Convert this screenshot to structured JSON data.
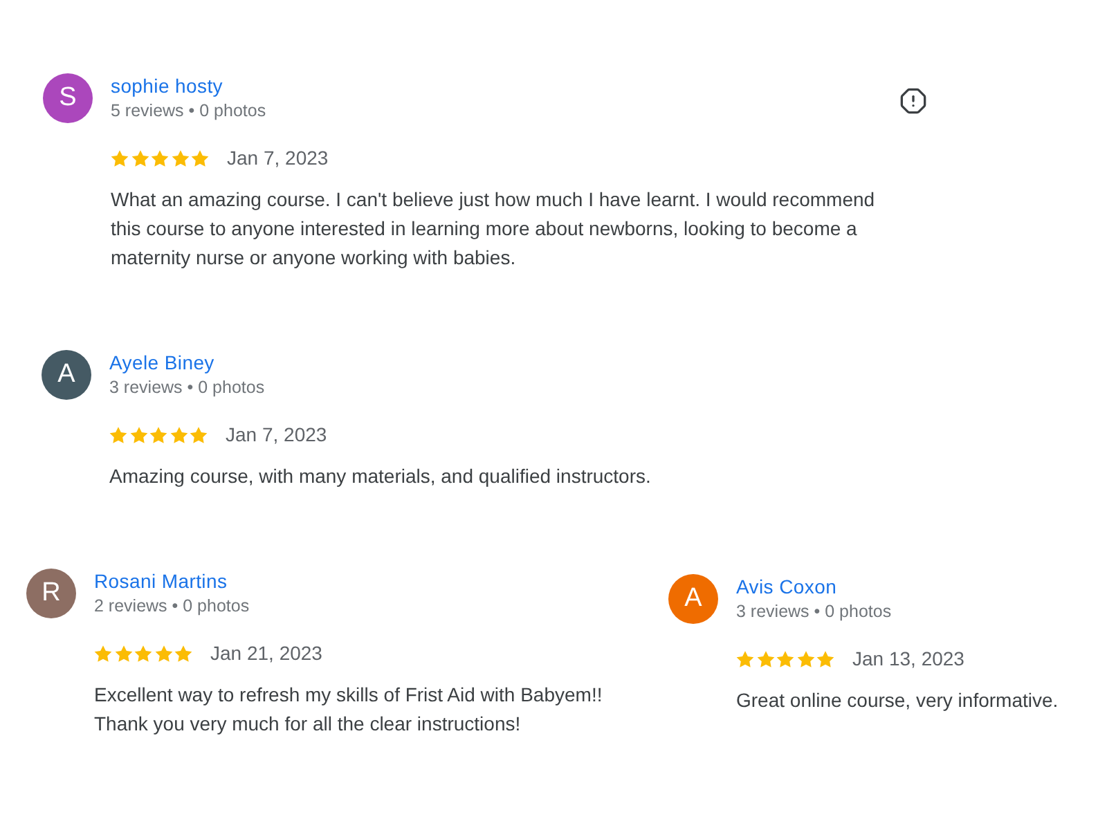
{
  "reviews": [
    {
      "author": "sophie hosty",
      "avatar_letter": "S",
      "color": "#ab47bc",
      "meta": "5 reviews • 0 photos",
      "stars": 5,
      "date": "Jan 7, 2023",
      "text": "What an amazing course. I can't believe just how much I have learnt. I would recommend this course to anyone interested in learning more about newborns, looking to become a maternity nurse or anyone working with babies.",
      "report_icon": true
    },
    {
      "author": "Ayele Biney",
      "avatar_letter": "A",
      "color": "#455a64",
      "meta": "3 reviews • 0 photos",
      "stars": 5,
      "date": "Jan 7, 2023",
      "text": "Amazing course, with many materials, and qualified instructors.",
      "report_icon": false
    },
    {
      "author": "Rosani Martins",
      "avatar_letter": "R",
      "color": "#8d6e63",
      "meta": "2 reviews • 0 photos",
      "stars": 5,
      "date": "Jan 21, 2023",
      "text": "Excellent way to refresh my skills of Frist Aid with Babyem!! Thank you very much for all the clear instructions!",
      "report_icon": false
    },
    {
      "author": "Avis Coxon",
      "avatar_letter": "A",
      "color": "#ef6c00",
      "meta": "3 reviews • 0 photos",
      "stars": 5,
      "date": "Jan 13, 2023",
      "text": "Great online course, very informative.",
      "report_icon": false
    }
  ]
}
